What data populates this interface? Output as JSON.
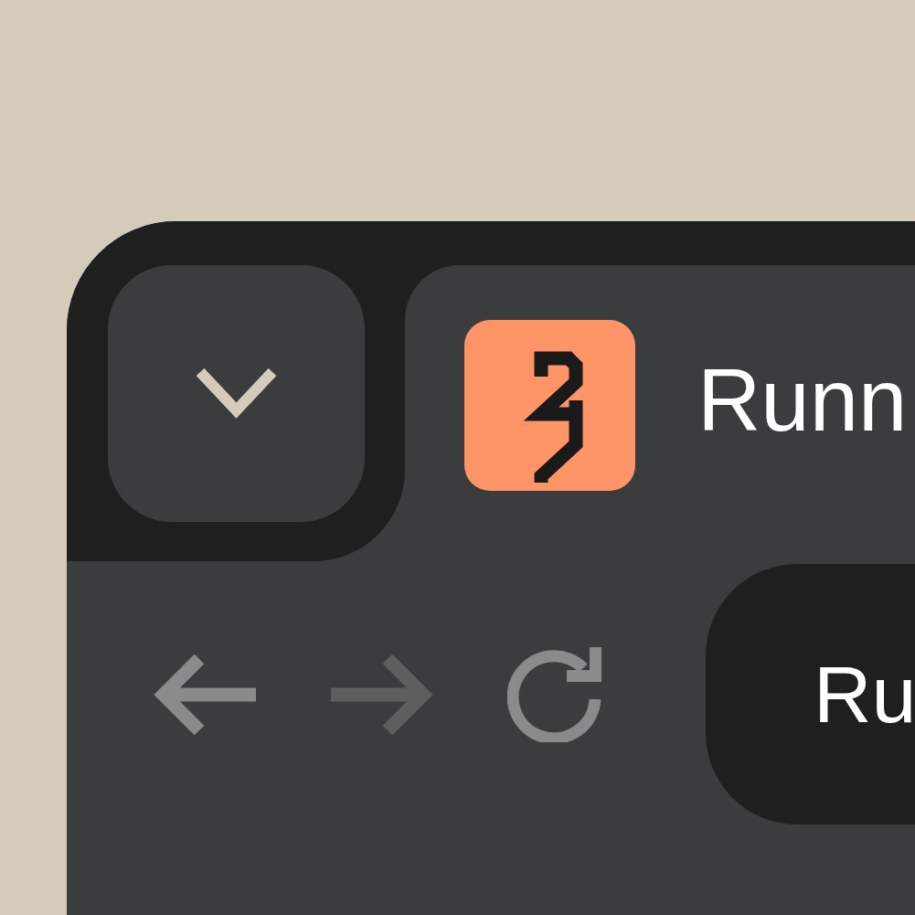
{
  "tabs": [
    {
      "title": "Runn",
      "selected": true
    }
  ],
  "toolbar": {
    "back": {
      "disabled": false
    },
    "forward": {
      "disabled": true
    }
  },
  "address_bar": {
    "value": "Ru"
  }
}
